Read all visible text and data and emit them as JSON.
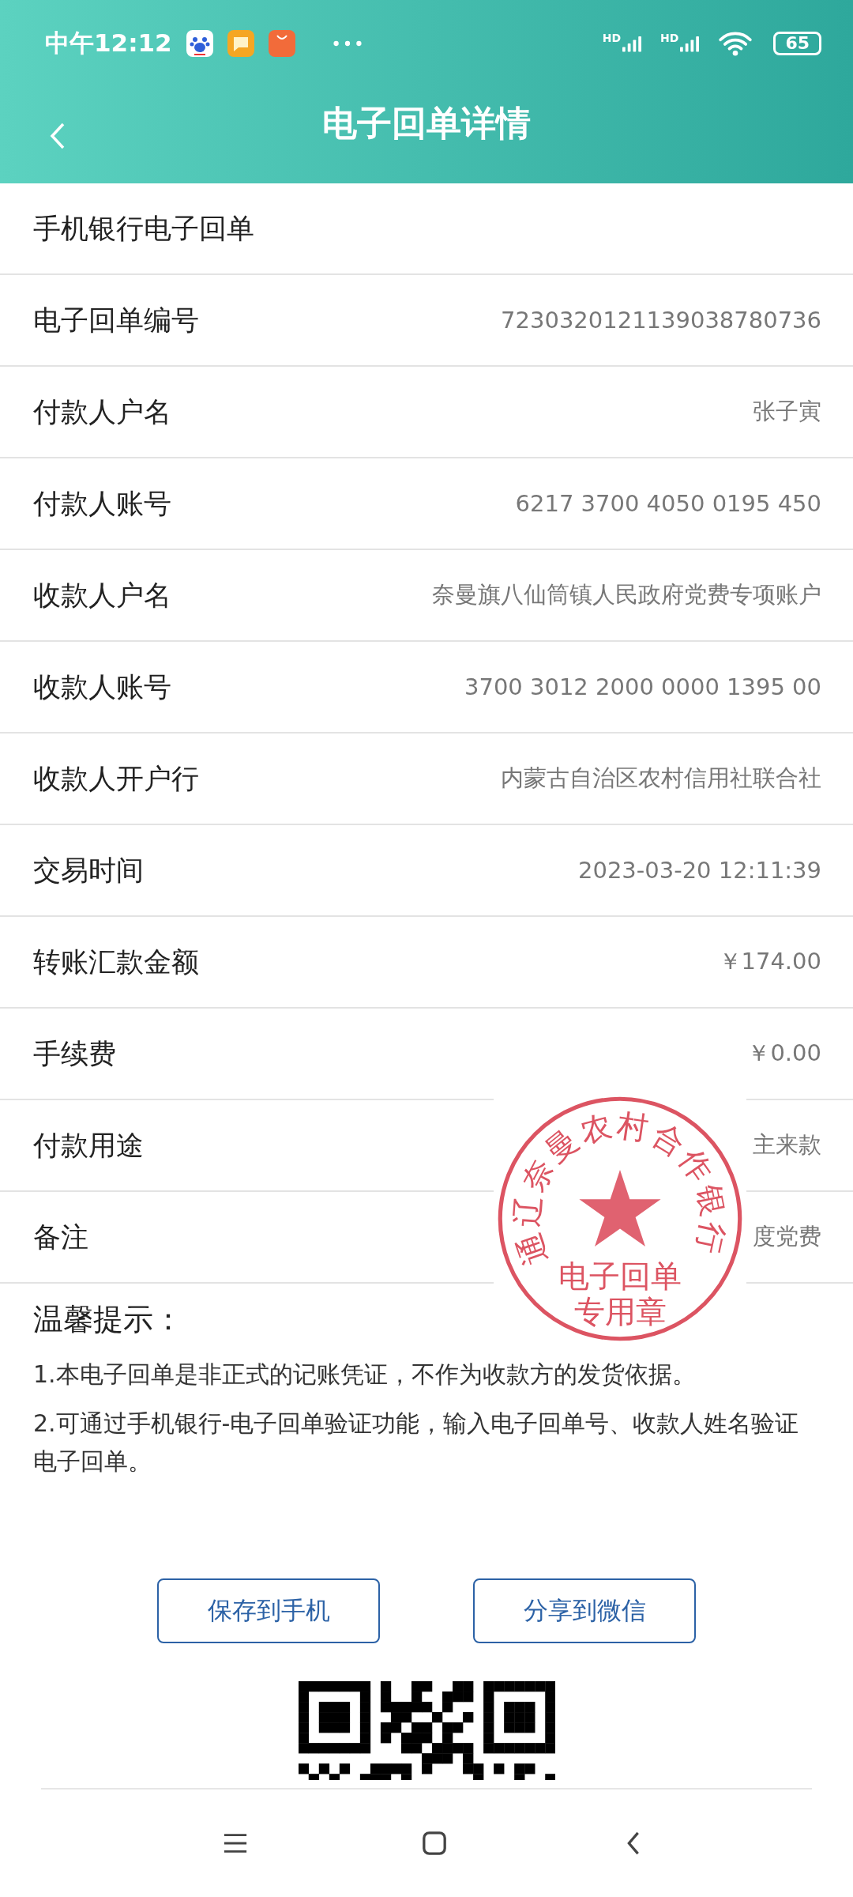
{
  "status_bar": {
    "time": "中午12:12",
    "network_1": "HD",
    "network_2": "HD",
    "battery": "65"
  },
  "header": {
    "title": "电子回单详情"
  },
  "receipt": {
    "title": "手机银行电子回单",
    "rows": [
      {
        "label": "电子回单编号",
        "value": "7230320121139038780736"
      },
      {
        "label": "付款人户名",
        "value": "张子寅"
      },
      {
        "label": "付款人账号",
        "value": "6217 3700 4050 0195 450"
      },
      {
        "label": "收款人户名",
        "value": "奈曼旗八仙筒镇人民政府党费专项账户"
      },
      {
        "label": "收款人账号",
        "value": "3700 3012 2000 0000 1395 00"
      },
      {
        "label": "收款人开户行",
        "value": "内蒙古自治区农村信用社联合社"
      },
      {
        "label": "交易时间",
        "value": "2023-03-20 12:11:39"
      },
      {
        "label": "转账汇款金额",
        "value": "￥174.00"
      },
      {
        "label": "手续费",
        "value": "￥0.00"
      },
      {
        "label": "付款用途",
        "value": "主来款"
      },
      {
        "label": "备注",
        "value": "度党费"
      }
    ]
  },
  "seal": {
    "ring_text": "通辽奈曼农村合作银行",
    "center_lines": [
      "电子回单",
      "专用章"
    ]
  },
  "tips": {
    "heading": "温馨提示：",
    "items": [
      "1.本电子回单是非正式的记账凭证，不作为收款方的发货依据。",
      "2.可通过手机银行-电子回单验证功能，输入电子回单号、收款人姓名验证电子回单。"
    ]
  },
  "buttons": [
    "保存到手机",
    "分享到微信"
  ]
}
